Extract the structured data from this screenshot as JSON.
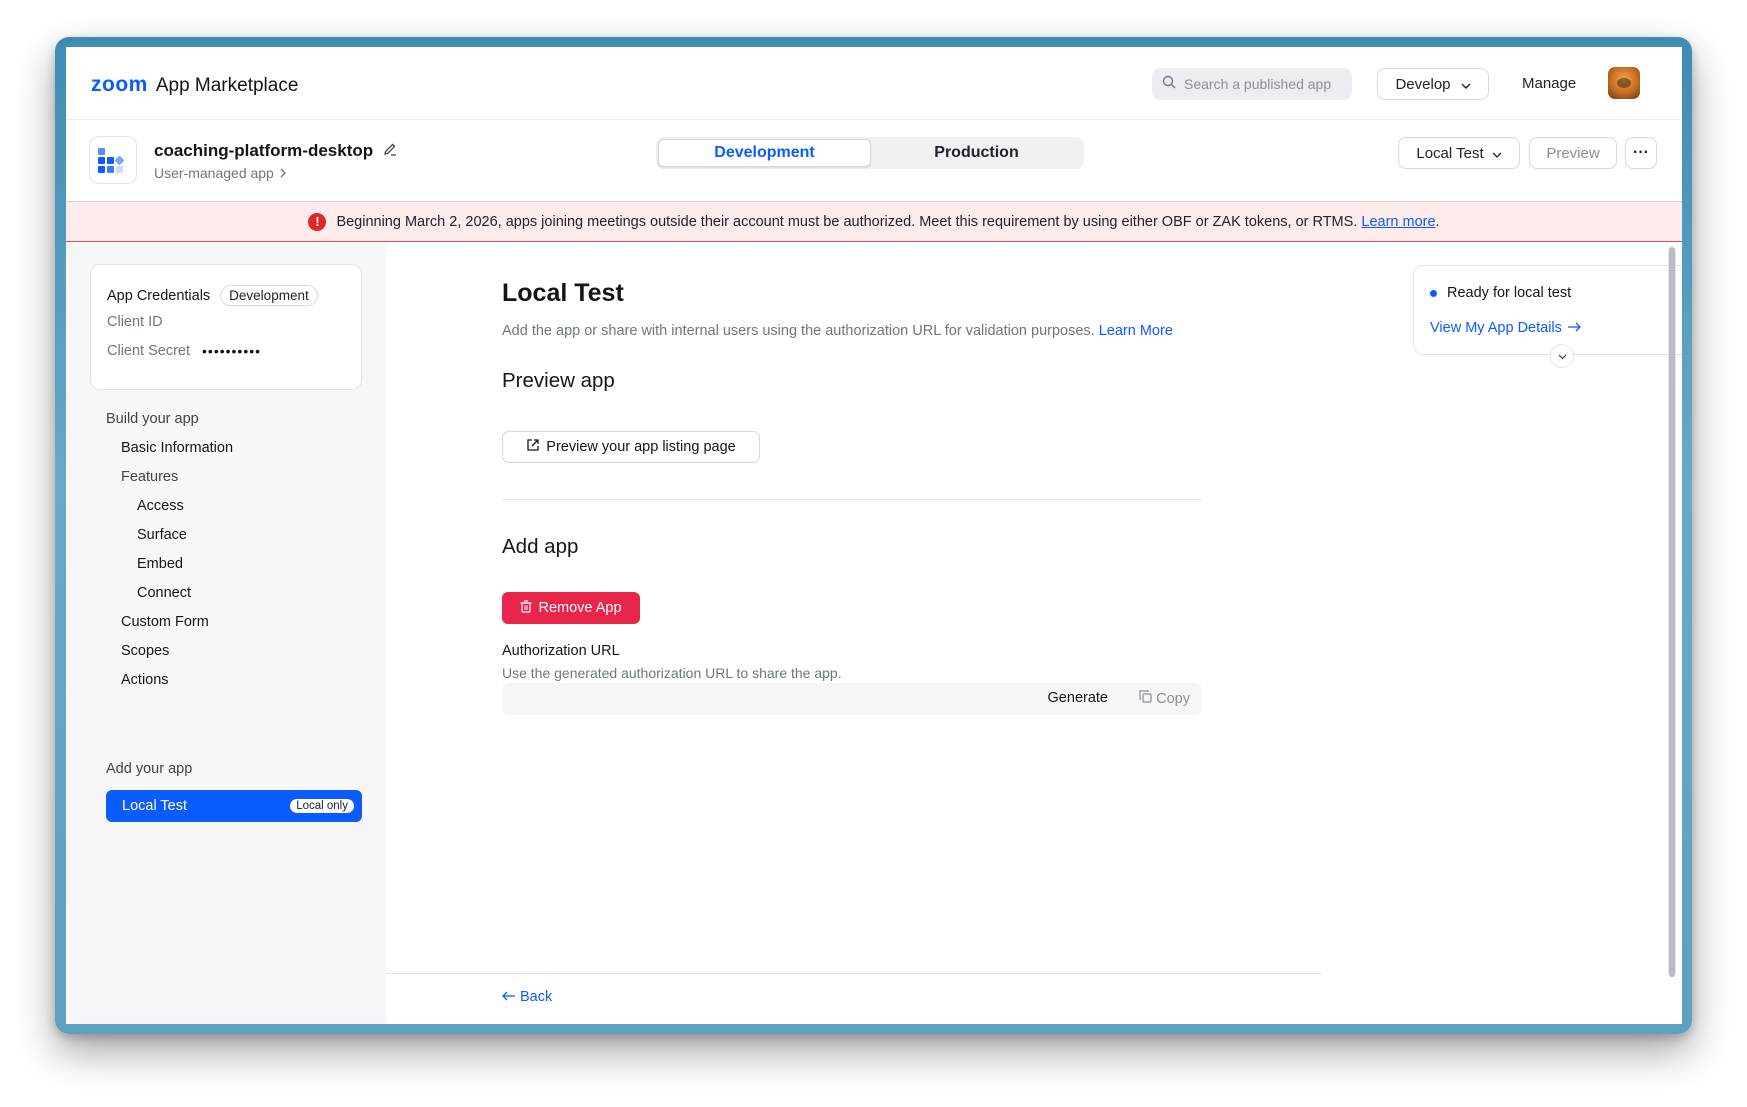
{
  "topnav": {
    "logo_brand": "zoom",
    "logo_text": "App Marketplace",
    "search_placeholder": "Search a published app",
    "develop_label": "Develop",
    "manage_label": "Manage"
  },
  "app": {
    "name": "coaching-platform-desktop",
    "subtitle": "User-managed app",
    "env_tabs": [
      "Development",
      "Production"
    ],
    "active_env": "Development",
    "local_test_label": "Local Test",
    "preview_label": "Preview",
    "more_label": "···"
  },
  "banner": {
    "text": "Beginning March 2, 2026, apps joining meetings outside their account must be authorized. Meet this requirement by using either OBF or ZAK tokens, or RTMS.",
    "link": "Learn more",
    "trailing": "."
  },
  "sidebar": {
    "credentials_title": "App Credentials",
    "credentials_badge": "Development",
    "client_id_label": "Client ID",
    "client_secret_label": "Client Secret",
    "client_secret_value": "••••••••••",
    "build_group": "Build your app",
    "items": [
      {
        "label": "Basic Information"
      },
      {
        "label": "Features"
      },
      {
        "label": "Access"
      },
      {
        "label": "Surface"
      },
      {
        "label": "Embed"
      },
      {
        "label": "Connect"
      },
      {
        "label": "Custom Form"
      },
      {
        "label": "Scopes"
      },
      {
        "label": "Actions"
      }
    ],
    "add_group": "Add your app",
    "active_item": "Local Test",
    "active_badge": "Local only"
  },
  "main": {
    "title": "Local Test",
    "description": "Add the app or share with internal users using the authorization URL for validation purposes.",
    "description_link": "Learn More",
    "preview_heading": "Preview app",
    "preview_button": "Preview your app listing page",
    "add_heading": "Add app",
    "remove_button": "Remove App",
    "auth_label": "Authorization URL",
    "auth_help": "Use the generated authorization URL to share the app.",
    "generate_label": "Generate",
    "copy_label": "Copy",
    "back_label": "Back"
  },
  "status": {
    "text": "Ready for local test",
    "link": "View My App Details"
  },
  "colors": {
    "accent": "#0b5cff",
    "danger": "#e8264a",
    "banner_bg": "#fdeceb"
  }
}
